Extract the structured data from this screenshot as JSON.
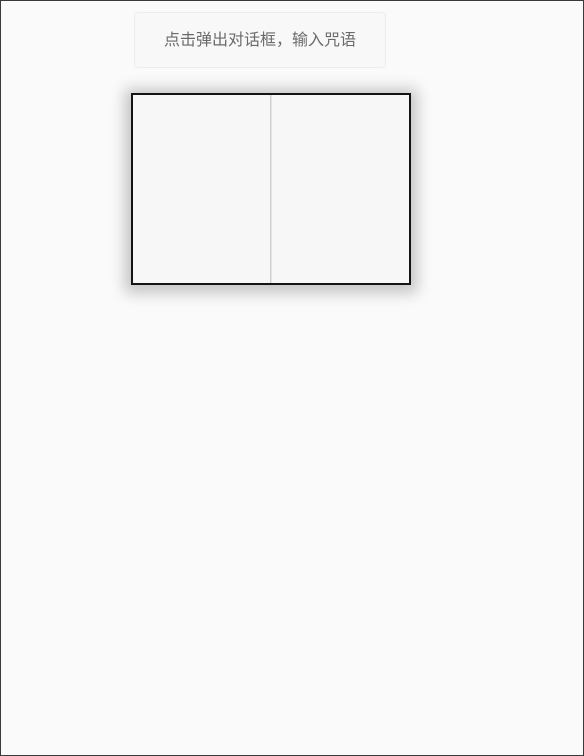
{
  "prompt_button": {
    "label": "点击弹出对话框，输入咒语"
  },
  "book": {
    "left_page_text": "",
    "right_page_text": ""
  }
}
